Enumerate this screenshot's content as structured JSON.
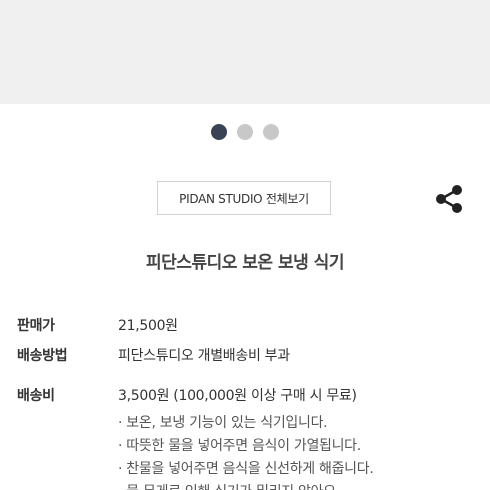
{
  "pagination": {
    "total": 3,
    "active": 1
  },
  "brand_button": {
    "label": "PIDAN STUDIO 전체보기"
  },
  "share": {
    "icon": "share-icon"
  },
  "product": {
    "title": "피단스튜디오 보온 보냉 식기"
  },
  "info": {
    "price_label": "판매가",
    "price_value": "21,500원",
    "method_label": "배송방법",
    "method_value": "피단스튜디오 개별배송비 부과",
    "fee_label": "배송비",
    "fee_value": "3,500원 (100,000원 이상 구매 시 무료)"
  },
  "features": [
    "· 보온, 보냉 기능이 있는 식기입니다.",
    "· 따뜻한 물을 넣어주면 음식이 가열됩니다.",
    "· 찬물을 넣어주면 음식을 신선하게 해줍니다.",
    "· 물 무게로 인해 식기가 밀리지 않아요."
  ],
  "colors": {
    "image_bg": "#f0f0f0",
    "dot_active": "#3a4256",
    "dot_inactive": "#c8c8c8"
  }
}
